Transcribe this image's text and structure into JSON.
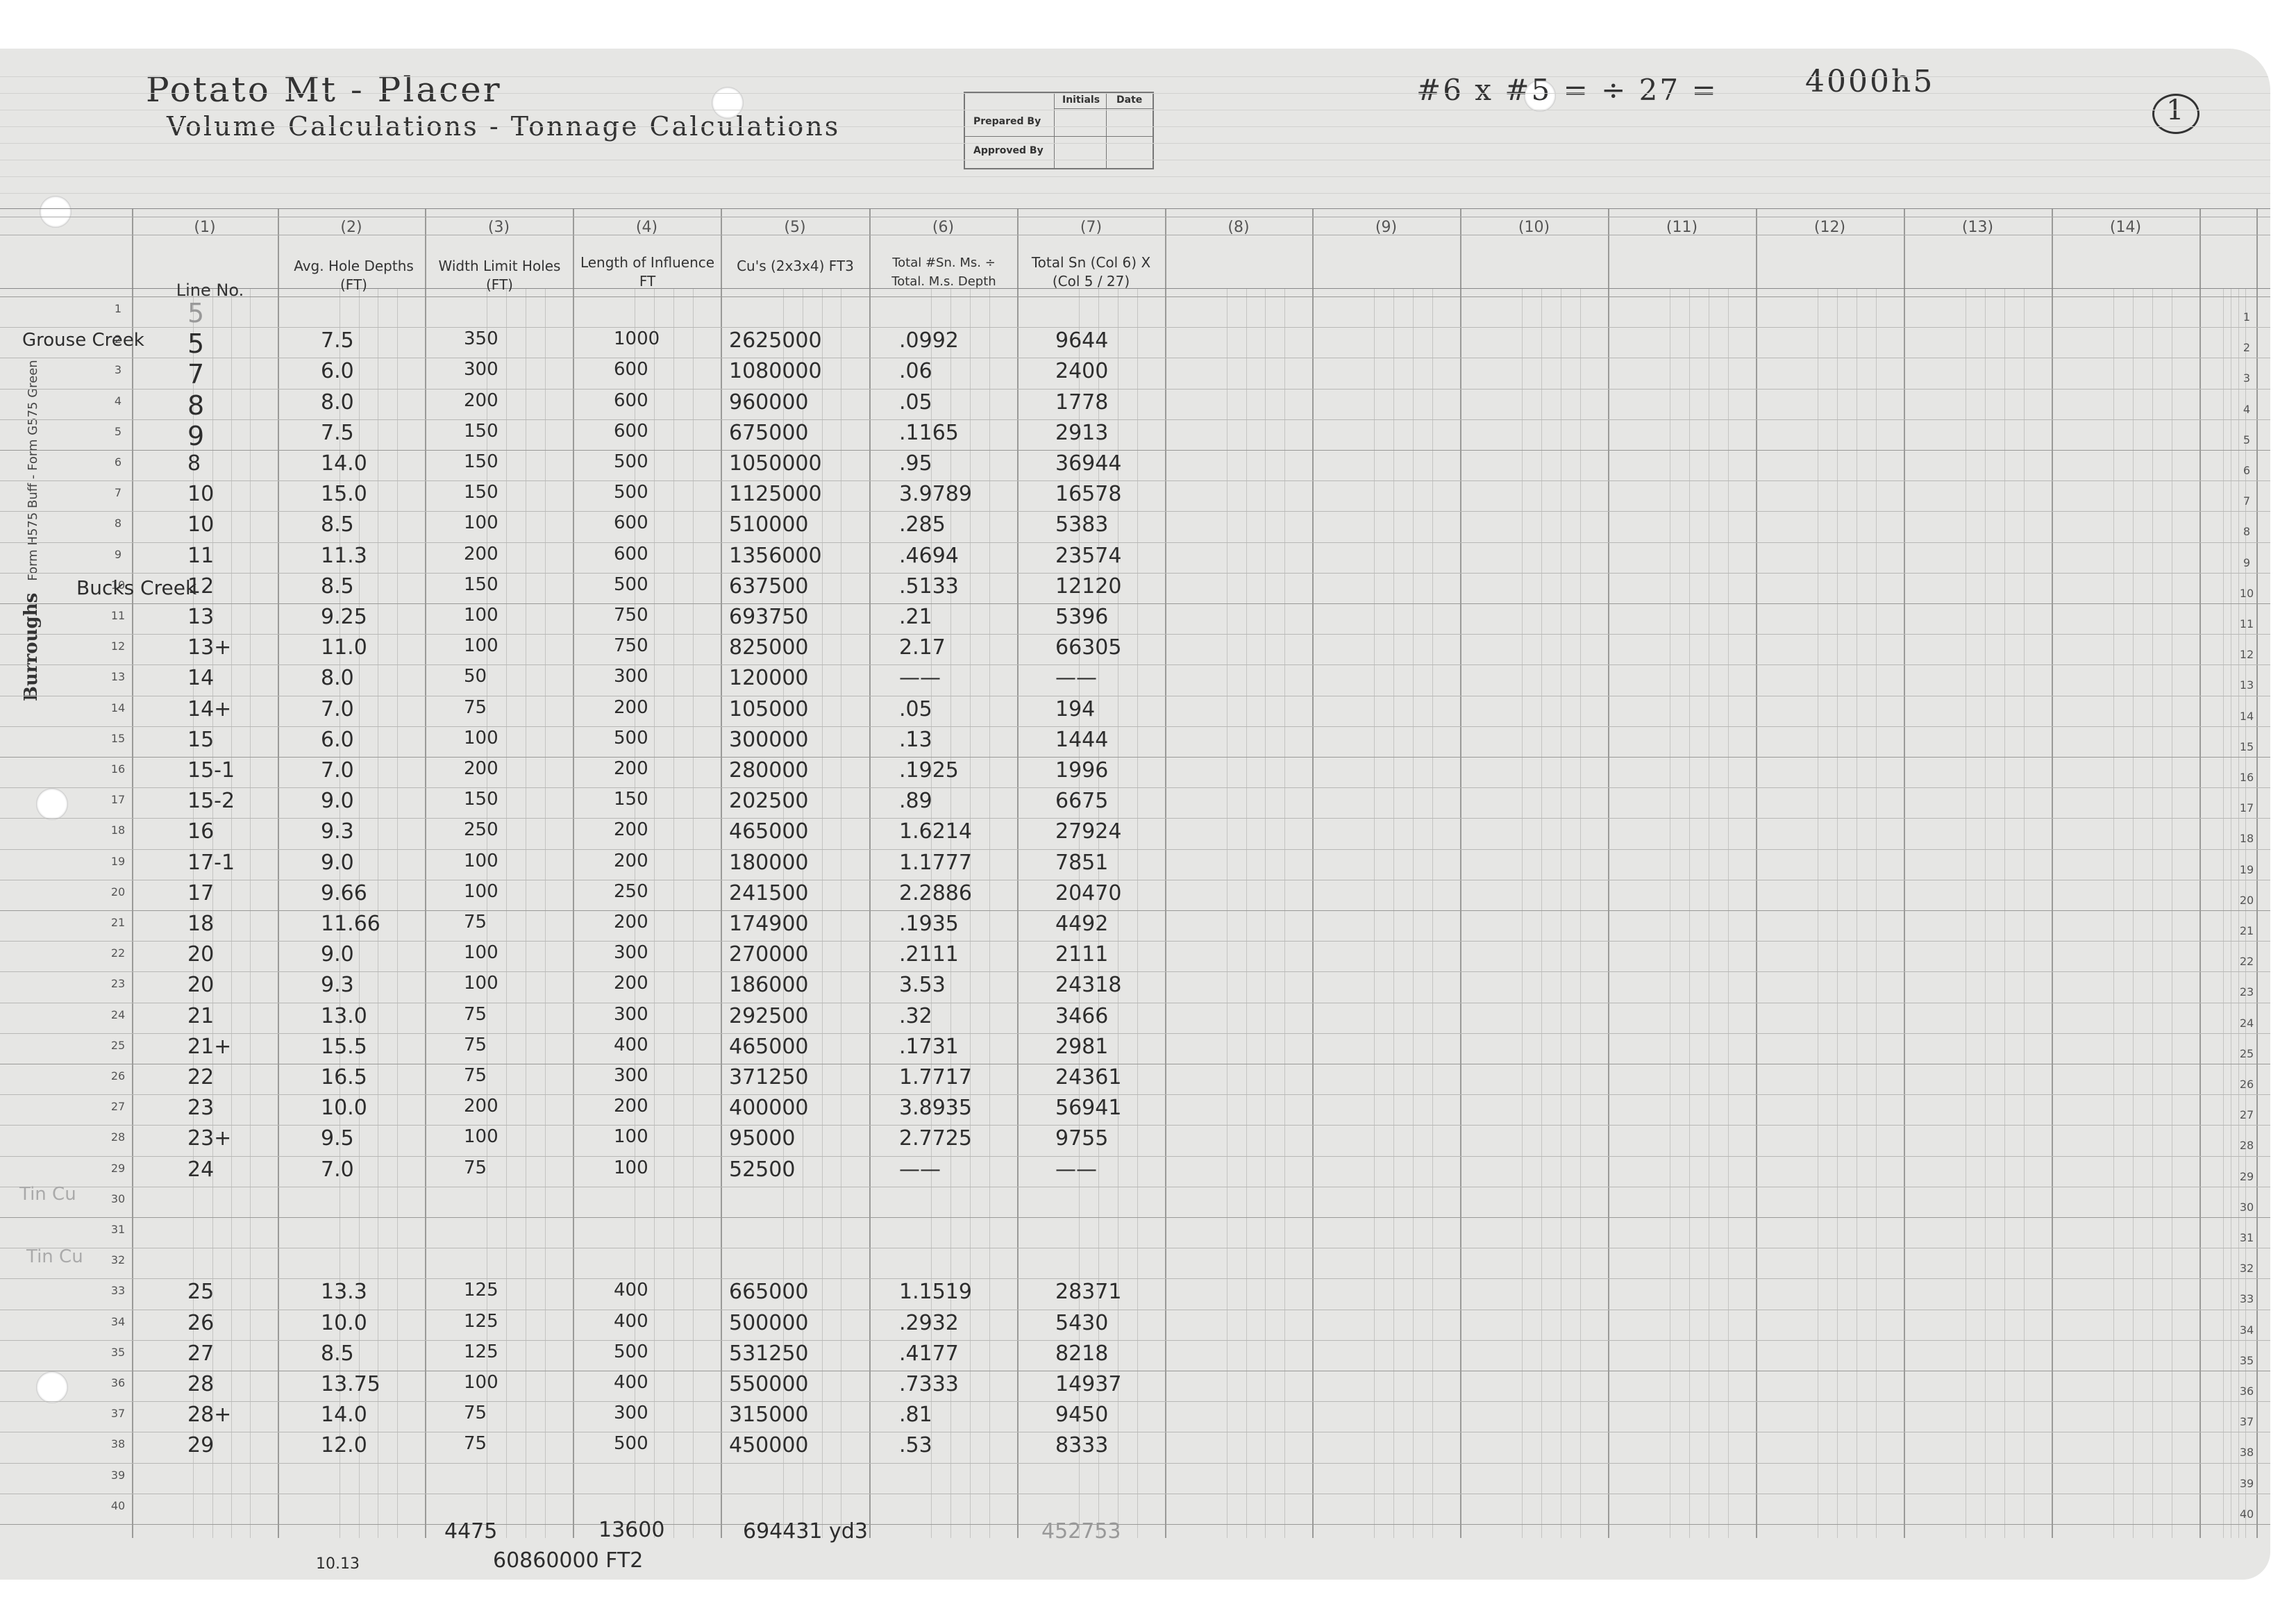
{
  "title": {
    "line1": "Potato Mt - Placer",
    "line2": "Volume Calculations - Tonnage Calculations",
    "formula": "#6 x #5 = ÷ 27 =",
    "doc_id": "4000h5",
    "page_number": "1"
  },
  "stamp": {
    "initials": "Initials",
    "date": "Date",
    "prepared_by": "Prepared By",
    "approved_by": "Approved By"
  },
  "form_label": {
    "brand": "Burroughs",
    "sub": "Form H575 Buff - Form G575 Green"
  },
  "column_numbers": [
    "(1)",
    "(2)",
    "(3)",
    "(4)",
    "(5)",
    "(6)",
    "(7)",
    "(8)",
    "(9)",
    "(10)",
    "(11)",
    "(12)",
    "(13)",
    "(14)"
  ],
  "headers": [
    "Line No.",
    "Avg. Hole Depths (FT)",
    "Width Limit Holes (FT)",
    "Length of Influence FT",
    "Cu's (2x3x4) FT3",
    "Total #Sn. Ms. ÷ Total. M.s. Depth",
    "Total Sn (Col 6) X (Col 5 / 27)"
  ],
  "row_numbers": [
    "1",
    "2",
    "3",
    "4",
    "5",
    "6",
    "7",
    "8",
    "9",
    "10",
    "11",
    "12",
    "13",
    "14",
    "15",
    "16",
    "17",
    "18",
    "19",
    "20",
    "21",
    "22",
    "23",
    "24",
    "25",
    "26",
    "27",
    "28",
    "29",
    "30",
    "31",
    "32",
    "33",
    "34",
    "35",
    "36",
    "37",
    "38",
    "39",
    "40"
  ],
  "creek_labels": {
    "grouse": "Grouse Creek",
    "bucks": "Bucks Creek",
    "tin1": "Tin Cu",
    "tin2": "Tin Cu"
  },
  "rows": [
    {
      "row": 1,
      "line": "5",
      "depth": "",
      "width": "",
      "length": "",
      "cuft": "",
      "sn": "",
      "total": ""
    },
    {
      "row": 2,
      "line": "5",
      "depth": "7.5",
      "width": "350",
      "length": "1000",
      "cuft": "2625000",
      "sn": ".0992",
      "total": "9644"
    },
    {
      "row": 3,
      "line": "7",
      "depth": "6.0",
      "width": "300",
      "length": "600",
      "cuft": "1080000",
      "sn": ".06",
      "total": "2400"
    },
    {
      "row": 4,
      "line": "8",
      "depth": "8.0",
      "width": "200",
      "length": "600",
      "cuft": "960000",
      "sn": ".05",
      "total": "1778"
    },
    {
      "row": 5,
      "line": "9",
      "depth": "7.5",
      "width": "150",
      "length": "600",
      "cuft": "675000",
      "sn": ".1165",
      "total": "2913"
    },
    {
      "row": 6,
      "line": "8",
      "depth": "14.0",
      "width": "150",
      "length": "500",
      "cuft": "1050000",
      "sn": ".95",
      "total": "36944"
    },
    {
      "row": 7,
      "line": "10",
      "depth": "15.0",
      "width": "150",
      "length": "500",
      "cuft": "1125000",
      "sn": "3.9789",
      "total": "16578"
    },
    {
      "row": 8,
      "line": "10",
      "depth": "8.5",
      "width": "100",
      "length": "600",
      "cuft": "510000",
      "sn": ".285",
      "total": "5383"
    },
    {
      "row": 9,
      "line": "11",
      "depth": "11.3",
      "width": "200",
      "length": "600",
      "cuft": "1356000",
      "sn": ".4694",
      "total": "23574"
    },
    {
      "row": 10,
      "line": "12",
      "depth": "8.5",
      "width": "150",
      "length": "500",
      "cuft": "637500",
      "sn": ".5133",
      "total": "12120"
    },
    {
      "row": 11,
      "line": "13",
      "depth": "9.25",
      "width": "100",
      "length": "750",
      "cuft": "693750",
      "sn": ".21",
      "total": "5396"
    },
    {
      "row": 12,
      "line": "13+",
      "depth": "11.0",
      "width": "100",
      "length": "750",
      "cuft": "825000",
      "sn": "2.17",
      "total": "66305"
    },
    {
      "row": 13,
      "line": "14",
      "depth": "8.0",
      "width": "50",
      "length": "300",
      "cuft": "120000",
      "sn": "——",
      "total": "——"
    },
    {
      "row": 14,
      "line": "14+",
      "depth": "7.0",
      "width": "75",
      "length": "200",
      "cuft": "105000",
      "sn": ".05",
      "total": "194"
    },
    {
      "row": 15,
      "line": "15",
      "depth": "6.0",
      "width": "100",
      "length": "500",
      "cuft": "300000",
      "sn": ".13",
      "total": "1444"
    },
    {
      "row": 16,
      "line": "15-1",
      "depth": "7.0",
      "width": "200",
      "length": "200",
      "cuft": "280000",
      "sn": ".1925",
      "total": "1996"
    },
    {
      "row": 17,
      "line": "15-2",
      "depth": "9.0",
      "width": "150",
      "length": "150",
      "cuft": "202500",
      "sn": ".89",
      "total": "6675"
    },
    {
      "row": 18,
      "line": "16",
      "depth": "9.3",
      "width": "250",
      "length": "200",
      "cuft": "465000",
      "sn": "1.6214",
      "total": "27924"
    },
    {
      "row": 19,
      "line": "17-1",
      "depth": "9.0",
      "width": "100",
      "length": "200",
      "cuft": "180000",
      "sn": "1.1777",
      "total": "7851"
    },
    {
      "row": 20,
      "line": "17",
      "depth": "9.66",
      "width": "100",
      "length": "250",
      "cuft": "241500",
      "sn": "2.2886",
      "total": "20470"
    },
    {
      "row": 21,
      "line": "18",
      "depth": "11.66",
      "width": "75",
      "length": "200",
      "cuft": "174900",
      "sn": ".1935",
      "total": "4492"
    },
    {
      "row": 22,
      "line": "20",
      "depth": "9.0",
      "width": "100",
      "length": "300",
      "cuft": "270000",
      "sn": ".2111",
      "total": "2111"
    },
    {
      "row": 23,
      "line": "20",
      "depth": "9.3",
      "width": "100",
      "length": "200",
      "cuft": "186000",
      "sn": "3.53",
      "total": "24318"
    },
    {
      "row": 24,
      "line": "21",
      "depth": "13.0",
      "width": "75",
      "length": "300",
      "cuft": "292500",
      "sn": ".32",
      "total": "3466"
    },
    {
      "row": 25,
      "line": "21+",
      "depth": "15.5",
      "width": "75",
      "length": "400",
      "cuft": "465000",
      "sn": ".1731",
      "total": "2981"
    },
    {
      "row": 26,
      "line": "22",
      "depth": "16.5",
      "width": "75",
      "length": "300",
      "cuft": "371250",
      "sn": "1.7717",
      "total": "24361"
    },
    {
      "row": 27,
      "line": "23",
      "depth": "10.0",
      "width": "200",
      "length": "200",
      "cuft": "400000",
      "sn": "3.8935",
      "total": "56941"
    },
    {
      "row": 28,
      "line": "23+",
      "depth": "9.5",
      "width": "100",
      "length": "100",
      "cuft": "95000",
      "sn": "2.7725",
      "total": "9755"
    },
    {
      "row": 29,
      "line": "24",
      "depth": "7.0",
      "width": "75",
      "length": "100",
      "cuft": "52500",
      "sn": "——",
      "total": "——"
    },
    {
      "row": 33,
      "line": "25",
      "depth": "13.3",
      "width": "125",
      "length": "400",
      "cuft": "665000",
      "sn": "1.1519",
      "total": "28371"
    },
    {
      "row": 34,
      "line": "26",
      "depth": "10.0",
      "width": "125",
      "length": "400",
      "cuft": "500000",
      "sn": ".2932",
      "total": "5430"
    },
    {
      "row": 35,
      "line": "27",
      "depth": "8.5",
      "width": "125",
      "length": "500",
      "cuft": "531250",
      "sn": ".4177",
      "total": "8218"
    },
    {
      "row": 36,
      "line": "28",
      "depth": "13.75",
      "width": "100",
      "length": "400",
      "cuft": "550000",
      "sn": ".7333",
      "total": "14937"
    },
    {
      "row": 37,
      "line": "28+",
      "depth": "14.0",
      "width": "75",
      "length": "300",
      "cuft": "315000",
      "sn": ".81",
      "total": "9450"
    },
    {
      "row": 38,
      "line": "29",
      "depth": "12.0",
      "width": "75",
      "length": "500",
      "cuft": "450000",
      "sn": ".53",
      "total": "8333"
    }
  ],
  "totals": {
    "width_total": "4475",
    "length_total": "13600",
    "cuft_total": "694431 yd3",
    "sn_total": "452753",
    "depth_avg": "10.13",
    "grand": "60860000 FT2"
  }
}
